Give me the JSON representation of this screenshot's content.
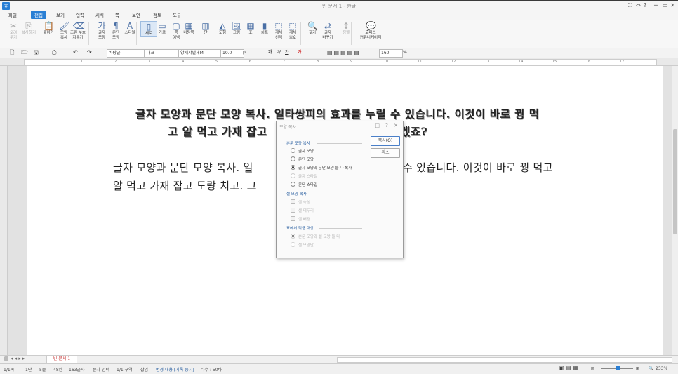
{
  "window": {
    "title": "빈 문서 1 - 한글",
    "controls": [
      "⛶",
      "⇔",
      "?",
      "─",
      "▭",
      "✕"
    ]
  },
  "menu": [
    "파일",
    "편집",
    "보기",
    "입력",
    "서식",
    "쪽",
    "보안",
    "검토",
    "도구"
  ],
  "ribbon": [
    {
      "label": "오려\n두기",
      "icon": "✂",
      "disabled": true
    },
    {
      "label": "복사하기",
      "icon": "⎘",
      "disabled": true
    },
    {
      "label": "붙이기",
      "icon": "📋",
      "disabled": false
    },
    {
      "label": "모양\n복사",
      "icon": "🖌",
      "disabled": false
    },
    {
      "label": "조판 부호\n지우기",
      "icon": "⌫",
      "disabled": false
    },
    {
      "label": "글자\n모양",
      "icon": "가",
      "disabled": false
    },
    {
      "label": "문단\n모양",
      "icon": "¶",
      "disabled": false
    },
    {
      "label": "스타일",
      "icon": "A",
      "disabled": false
    },
    {
      "label": "세로",
      "icon": "▯",
      "disabled": false
    },
    {
      "label": "가로",
      "icon": "▭",
      "disabled": false
    },
    {
      "label": "쪽\n여백",
      "icon": "▢",
      "disabled": false
    },
    {
      "label": "바탕쪽",
      "icon": "▦",
      "disabled": false
    },
    {
      "label": "단",
      "icon": "▥",
      "disabled": false
    },
    {
      "label": "도형",
      "icon": "◭",
      "disabled": false
    },
    {
      "label": "그림",
      "icon": "🖼",
      "disabled": false
    },
    {
      "label": "표",
      "icon": "▦",
      "disabled": false
    },
    {
      "label": "차트",
      "icon": "▮",
      "disabled": false
    },
    {
      "label": "개체\n선택",
      "icon": "⬚",
      "disabled": false
    },
    {
      "label": "개체\n보호",
      "icon": "⬚",
      "disabled": false
    },
    {
      "label": "찾기",
      "icon": "🔍",
      "disabled": false
    },
    {
      "label": "글자\n바꾸기",
      "icon": "⇄",
      "disabled": false
    },
    {
      "label": "정렬",
      "icon": "↕",
      "disabled": true
    },
    {
      "label": "오피스\n커뮤니케이터",
      "icon": "💬",
      "disabled": false
    }
  ],
  "formatbar": {
    "style": "바탕글",
    "lang": "대표",
    "font": "양재샤넬체M",
    "size": "10.0",
    "unit": "pt",
    "bold": "가",
    "italic": "가",
    "underline": "가",
    "color": "가",
    "zoom": "160",
    "zoom_unit": "%"
  },
  "ruler_numbers": [
    "1",
    "2",
    "3",
    "4",
    "5",
    "6",
    "7",
    "8",
    "9",
    "10",
    "11",
    "12",
    "13",
    "14",
    "15",
    "16",
    "17"
  ],
  "document": {
    "para1_line1": "글자 모양과 문단 모양 복사. 일타쌍피의 효과를 누릴 수 있습니다. 이것이 바로 꿩 먹",
    "para1_line2a": "고 알 먹고 가재 잡고",
    "para1_line2b": "겠죠?",
    "para2_line1a": "글자 모양과 문단 모양 복사. 일",
    "para2_line1b": "수 있습니다. 이것이 바로 꿩 먹고",
    "para2_line2a": "알 먹고 가재 잡고 도랑 치고. 그"
  },
  "dialog": {
    "title": "모양 복사",
    "controls": "□ ? ✕",
    "group1": "본문 모양 복사",
    "opts1": [
      "글자 모양",
      "문단 모양",
      "글자 모양과 문단 모양 둘 다 복사",
      "글자 스타일",
      "문단 스타일"
    ],
    "group2": "셀 모양 복사",
    "opts2": [
      "셀 속성",
      "셀 테두리",
      "셀 배경"
    ],
    "group3": "표에서 적용 대상",
    "opts3": [
      "본문 모양과 셀 모양 둘 다",
      "셀 모양만"
    ],
    "btn_copy": "복사(O)",
    "btn_cancel": "취소"
  },
  "tabs": {
    "doc_tab": "빈 문서 1",
    "add": "+"
  },
  "status": [
    "1/1쪽",
    "1단",
    "5줄",
    "48칸",
    "163글자",
    "문자 입력",
    "1/1 구역",
    "삽입",
    "변경 내용 [기록 중지]",
    "타수 : 50타"
  ],
  "zoom_status": "233%"
}
